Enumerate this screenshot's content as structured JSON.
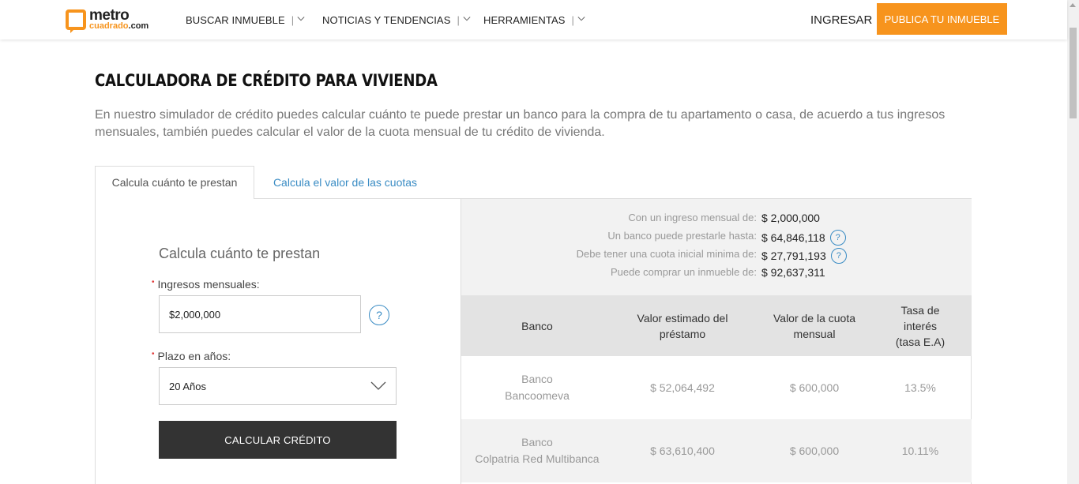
{
  "header": {
    "logo_top": "metro",
    "logo_bottom_brand": "cuadrado",
    "logo_bottom_tld": ".com",
    "nav": [
      {
        "label": "BUSCAR INMUEBLE",
        "sep": "|"
      },
      {
        "label": "NOTICIAS Y TENDENCIAS",
        "sep": "|"
      },
      {
        "label": "HERRAMIENTAS",
        "sep": "|"
      }
    ],
    "login": "INGRESAR",
    "publish": "PUBLICA TU INMUEBLE"
  },
  "page": {
    "title": "CALCULADORA DE CRÉDITO PARA VIVIENDA",
    "intro": "En nuestro simulador de crédito puedes calcular cuánto te puede prestar un banco para la compra de tu apartamento o casa, de acuerdo a tus ingresos mensuales, también puedes calcular el valor de la cuota mensual de tu crédito de vivienda."
  },
  "tabs": [
    {
      "label": "Calcula cuánto te prestan",
      "active": true
    },
    {
      "label": "Calcula el valor de las cuotas",
      "active": false
    }
  ],
  "form": {
    "title": "Calcula cuánto te prestan",
    "required_mark": "•",
    "income_label": "Ingresos mensuales:",
    "income_value": "$2,000,000",
    "help": "?",
    "term_label": "Plazo en años:",
    "term_value": "20 Años",
    "submit": "CALCULAR CRÉDITO"
  },
  "summary": [
    {
      "label": "Con un ingreso mensual de:",
      "value": "$ 2,000,000",
      "help": false
    },
    {
      "label": "Un banco puede prestarle hasta:",
      "value": "$ 64,846,118",
      "help": true
    },
    {
      "label": "Debe tener una cuota inicial minima de:",
      "value": "$ 27,791,193",
      "help": true
    },
    {
      "label": "Puede comprar un inmueble de:",
      "value": "$ 92,637,311",
      "help": false
    }
  ],
  "table": {
    "headers": [
      "Banco",
      "Valor estimado del préstamo",
      "Valor de la cuota mensual",
      "Tasa de interés (tasa E.A)"
    ],
    "rows": [
      {
        "bank_line1": "Banco",
        "bank_line2": "Bancoomeva",
        "loan": "$ 52,064,492",
        "fee": "$ 600,000",
        "rate": "13.5%"
      },
      {
        "bank_line1": "Banco",
        "bank_line2": "Colpatria Red Multibanca",
        "loan": "$ 63,610,400",
        "fee": "$ 600,000",
        "rate": "10.11%"
      }
    ]
  },
  "colors": {
    "accent": "#f7941d",
    "link": "#3a8cc4",
    "button_dark": "#333333"
  }
}
